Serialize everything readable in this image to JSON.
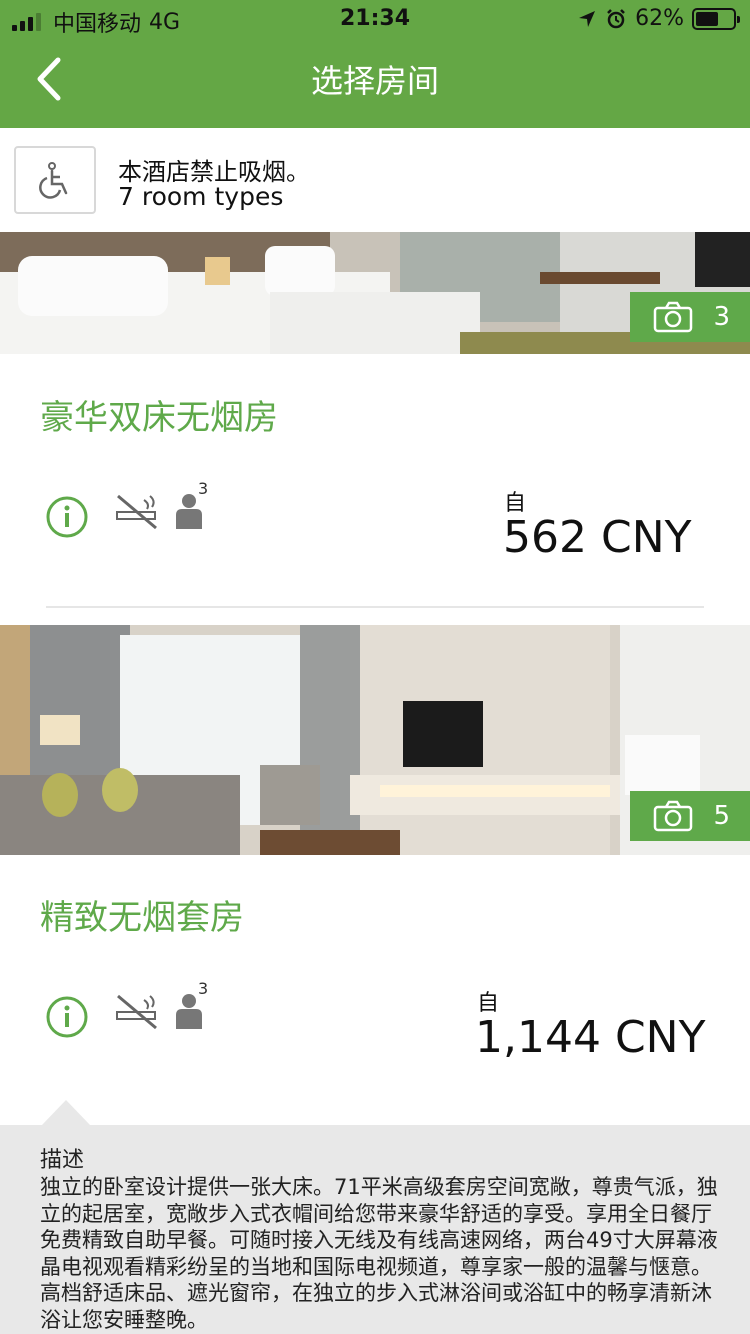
{
  "status_bar": {
    "carrier": "中国移动",
    "network": "4G",
    "time": "21:34",
    "battery": "62%",
    "battery_level": 0.62
  },
  "nav": {
    "title": "选择房间"
  },
  "info": {
    "no_smoking": "本酒店禁止吸烟。",
    "room_types": "7 room types"
  },
  "rooms": [
    {
      "name": "豪华双床无烟房",
      "photo_count": "3",
      "occupancy": "3",
      "from_label": "自",
      "price": "562 CNY"
    },
    {
      "name": "精致无烟套房",
      "photo_count": "5",
      "occupancy": "3",
      "from_label": "自",
      "price": "1,144 CNY"
    }
  ],
  "description": {
    "title": "描述",
    "body": "独立的卧室设计提供一张大床。71平米高级套房空间宽敞，尊贵气派，独立的起居室，宽敞步入式衣帽间给您带来豪华舒适的享受。享用全日餐厅免费精致自助早餐。可随时接入无线及有线高速网络，两台49寸大屏幕液晶电视观看精彩纷呈的当地和国际电视频道，尊享家一般的温馨与惬意。高档舒适床品、遮光窗帘，在独立的步入式淋浴间或浴缸中的畅享清新沐浴让您安睡整晚。"
  },
  "colors": {
    "brand_green": "#64a745",
    "desc_bg": "#e8e8e8"
  }
}
